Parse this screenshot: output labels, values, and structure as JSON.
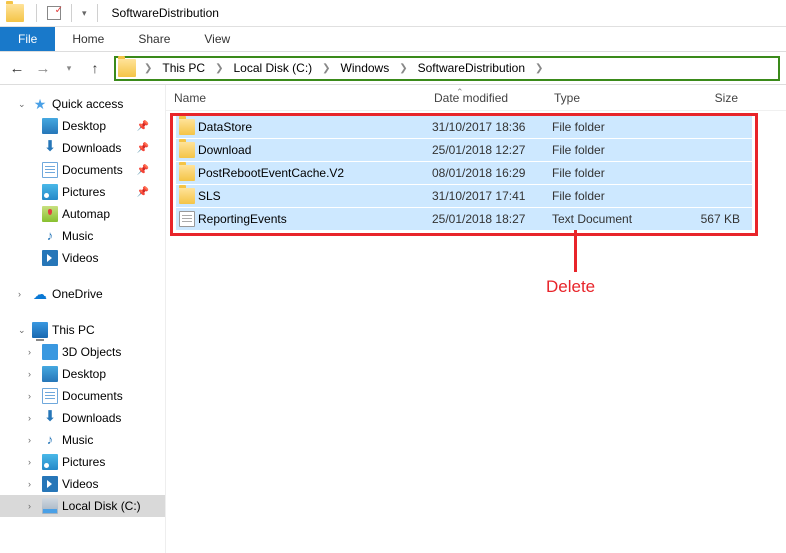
{
  "titlebar": {
    "title": "SoftwareDistribution"
  },
  "tabs": {
    "file": "File",
    "home": "Home",
    "share": "Share",
    "view": "View"
  },
  "breadcrumb": [
    "This PC",
    "Local Disk (C:)",
    "Windows",
    "SoftwareDistribution"
  ],
  "columns": {
    "name": "Name",
    "date": "Date modified",
    "type": "Type",
    "size": "Size"
  },
  "rows": [
    {
      "icon": "folder",
      "name": "DataStore",
      "date": "31/10/2017 18:36",
      "type": "File folder",
      "size": ""
    },
    {
      "icon": "folder",
      "name": "Download",
      "date": "25/01/2018 12:27",
      "type": "File folder",
      "size": ""
    },
    {
      "icon": "folder",
      "name": "PostRebootEventCache.V2",
      "date": "08/01/2018 16:29",
      "type": "File folder",
      "size": ""
    },
    {
      "icon": "folder",
      "name": "SLS",
      "date": "31/10/2017 17:41",
      "type": "File folder",
      "size": ""
    },
    {
      "icon": "txt",
      "name": "ReportingEvents",
      "date": "25/01/2018 18:27",
      "type": "Text Document",
      "size": "567 KB"
    }
  ],
  "sidebar": {
    "quick_access": "Quick access",
    "qa_items": [
      {
        "icon": "desktop",
        "label": "Desktop",
        "pinned": true
      },
      {
        "icon": "downloads",
        "label": "Downloads",
        "pinned": true
      },
      {
        "icon": "doc",
        "label": "Documents",
        "pinned": true
      },
      {
        "icon": "pictures",
        "label": "Pictures",
        "pinned": true
      },
      {
        "icon": "map",
        "label": "Automap",
        "pinned": false
      },
      {
        "icon": "music",
        "label": "Music",
        "pinned": false
      },
      {
        "icon": "video",
        "label": "Videos",
        "pinned": false
      }
    ],
    "onedrive": "OneDrive",
    "this_pc": "This PC",
    "pc_items": [
      {
        "icon": "3d",
        "label": "3D Objects"
      },
      {
        "icon": "desktop",
        "label": "Desktop"
      },
      {
        "icon": "doc",
        "label": "Documents"
      },
      {
        "icon": "downloads",
        "label": "Downloads"
      },
      {
        "icon": "music",
        "label": "Music"
      },
      {
        "icon": "pictures",
        "label": "Pictures"
      },
      {
        "icon": "video",
        "label": "Videos"
      },
      {
        "icon": "disk",
        "label": "Local Disk (C:)"
      }
    ]
  },
  "annotation": {
    "label": "Delete"
  }
}
